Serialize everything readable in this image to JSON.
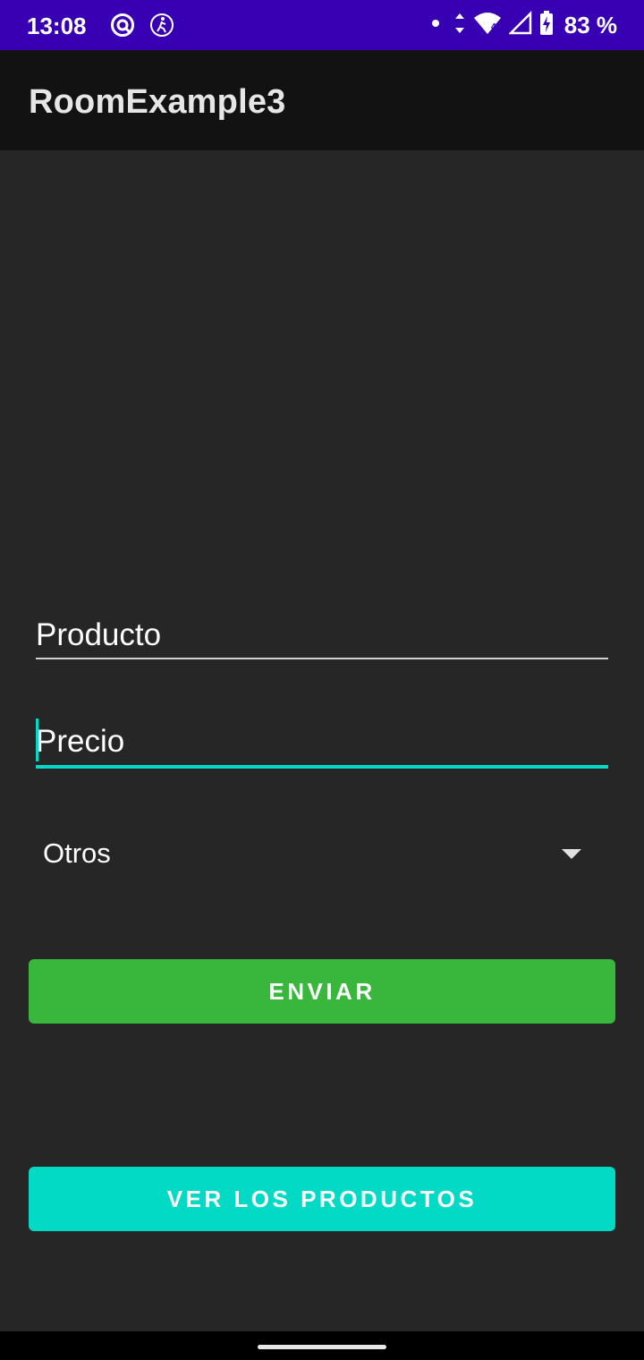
{
  "status_bar": {
    "time": "13:08",
    "left_icons": [
      "vpn-icon",
      "accessibility-icon"
    ],
    "right_icons": [
      "notification-dot-icon",
      "data-arrows-icon",
      "wifi-icon",
      "signal-icon",
      "battery-charging-icon"
    ],
    "battery": "83 %",
    "background": "#3700b3"
  },
  "app_bar": {
    "title": "RoomExample3",
    "background": "#121212"
  },
  "form": {
    "product_field": {
      "placeholder": "Producto",
      "value": ""
    },
    "price_field": {
      "placeholder": "Precio",
      "value": "",
      "focused": true
    },
    "category_spinner": {
      "selected": "Otros"
    },
    "accent_color": "#03dac5"
  },
  "buttons": {
    "send": {
      "label": "ENVIAR",
      "color": "#39b73d"
    },
    "view_products": {
      "label": "VER LOS PRODUCTOS",
      "color": "#03dac5"
    }
  }
}
